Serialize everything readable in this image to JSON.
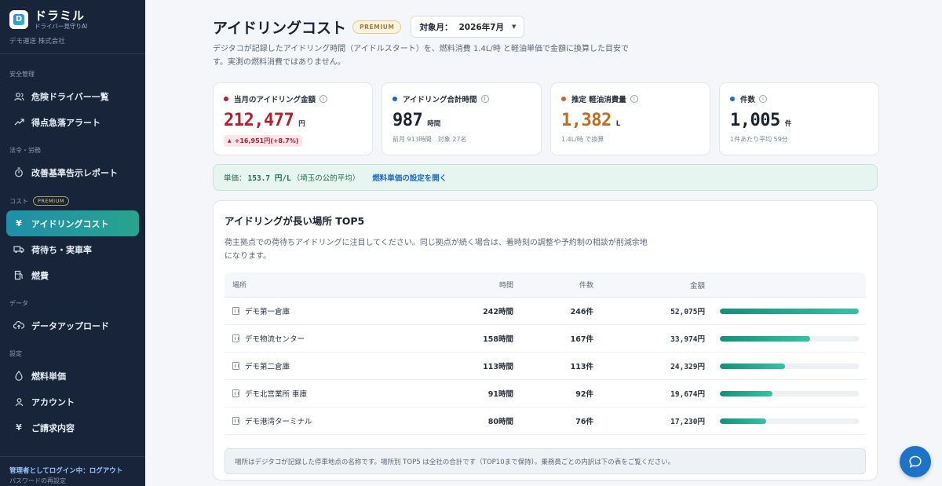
{
  "brand": {
    "name": "ドラミル",
    "tagline": "ドライバー見守りAI",
    "company": "デモ運送 株式会社",
    "logo_letter": "D"
  },
  "sidebar": {
    "sections": [
      {
        "label": "安全管理",
        "items": [
          {
            "label": "危険ドライバー一覧",
            "icon": "users-icon"
          },
          {
            "label": "得点急落アラート",
            "icon": "trend-icon"
          }
        ]
      },
      {
        "label": "法令・労務",
        "items": [
          {
            "label": "改善基準告示レポート",
            "icon": "stopwatch-icon"
          }
        ]
      },
      {
        "label": "コスト",
        "badge": "PREMIUM",
        "items": [
          {
            "label": "アイドリングコスト",
            "icon": "yen-icon",
            "active": true
          },
          {
            "label": "荷待ち・実車率",
            "icon": "truck-icon"
          },
          {
            "label": "燃費",
            "icon": "fuel-icon"
          }
        ]
      },
      {
        "label": "データ",
        "items": [
          {
            "label": "データアップロード",
            "icon": "cloud-upload-icon"
          }
        ]
      },
      {
        "label": "設定",
        "items": [
          {
            "label": "燃料単価",
            "icon": "drop-icon"
          },
          {
            "label": "アカウント",
            "icon": "user-icon"
          },
          {
            "label": "ご請求内容",
            "icon": "yen-icon"
          }
        ]
      }
    ],
    "footer": {
      "login_status": "管理者としてログイン中：ログアウト",
      "password_link": "パスワードの再設定"
    }
  },
  "header": {
    "title": "アイドリングコスト",
    "badge": "PREMIUM",
    "month_label": "対象月：",
    "month_value": "2026年7月"
  },
  "description": "デジタコが記録したアイドリング時間（アイドルスタート）を、燃料消費 1.4L/時 と軽油単価で金額に換算した目安です。実測の燃料消費ではありません。",
  "cards": [
    {
      "title": "当月のアイドリング金額",
      "value": "212,477",
      "unit": "円",
      "delta": "+16,951円(+8.7%)",
      "dot_color": "#c0202e",
      "value_color": "#b3202e"
    },
    {
      "title": "アイドリング合計時間",
      "value": "987",
      "unit": "時間",
      "sub": "前月 913時間　対象 27名",
      "dot_color": "#1a6ad0",
      "value_color": "#1b2330"
    },
    {
      "title": "推定 軽油消費量",
      "value": "1,382",
      "unit": "L",
      "sub": "1.4L/時 で換算",
      "dot_color": "#c76a1b",
      "value_color": "#c76a1b"
    },
    {
      "title": "件数",
      "value": "1,005",
      "unit": "件",
      "sub": "1件あたり平均 59分",
      "dot_color": "#1a6ad0",
      "value_color": "#1b2330"
    }
  ],
  "unit_price": {
    "prefix": "単価：",
    "value": "153.7 円/L",
    "suffix": "（埼玉の公的平均）",
    "link": "燃料単価の設定を開く"
  },
  "top5": {
    "title": "アイドリングが長い場所 TOP5",
    "description": "荷主拠点での荷待ちアイドリングに注目してください。同じ拠点が続く場合は、着時刻の調整や予約制の相談が削減余地になります。",
    "columns": {
      "place": "場所",
      "time": "時間",
      "count": "件数",
      "amount": "金額"
    },
    "rows": [
      {
        "place": "デモ第一倉庫",
        "time": "242時間",
        "count": "246件",
        "amount": "52,075円",
        "share": 1.0
      },
      {
        "place": "デモ物流センター",
        "time": "158時間",
        "count": "167件",
        "amount": "33,974円",
        "share": 0.652
      },
      {
        "place": "デモ第二倉庫",
        "time": "113時間",
        "count": "113件",
        "amount": "24,329円",
        "share": 0.467
      },
      {
        "place": "デモ北営業所 車庫",
        "time": "91時間",
        "count": "92件",
        "amount": "19,674円",
        "share": 0.378
      },
      {
        "place": "デモ港湾ターミナル",
        "time": "80時間",
        "count": "76件",
        "amount": "17,230円",
        "share": 0.331
      }
    ],
    "note": "場所はデジタコが記録した停車地点の名称です。場所別 TOP5 は全社の合計です（TOP10まで保持）。乗務員ごとの内訳は下の表をご覧ください。"
  },
  "chat": {
    "icon": "chat-icon"
  }
}
